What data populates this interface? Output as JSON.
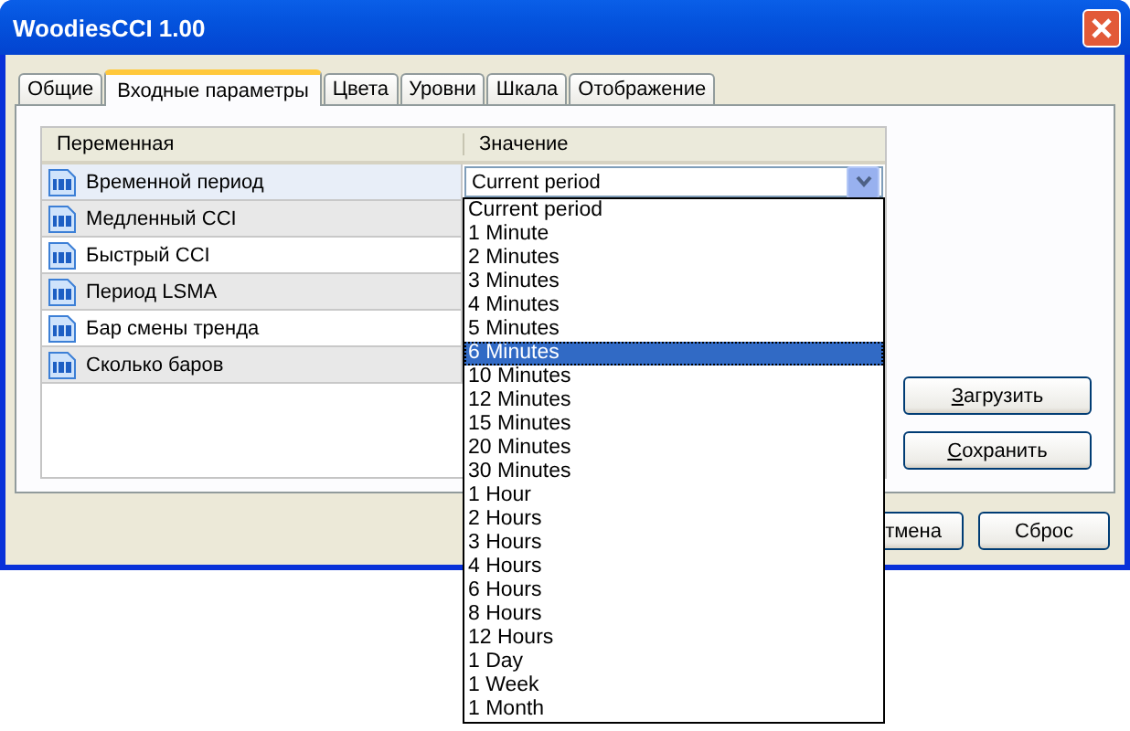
{
  "window": {
    "title": "WoodiesCCI 1.00"
  },
  "tabs": [
    {
      "label": "Общие",
      "selected": false
    },
    {
      "label": "Входные параметры",
      "selected": true
    },
    {
      "label": "Цвета",
      "selected": false
    },
    {
      "label": "Уровни",
      "selected": false
    },
    {
      "label": "Шкала",
      "selected": false
    },
    {
      "label": "Отображение",
      "selected": false
    }
  ],
  "table": {
    "columns": [
      "Переменная",
      "Значение"
    ],
    "rows": [
      {
        "name": "Временной период",
        "selected": true,
        "value": {
          "kind": "combo",
          "text": "Current period",
          "expanded": true
        }
      },
      {
        "name": "Медленный CCI",
        "selected": false
      },
      {
        "name": "Быстрый CCI",
        "selected": false
      },
      {
        "name": "Период LSMA",
        "selected": false
      },
      {
        "name": "Бар смены тренда",
        "selected": false
      },
      {
        "name": "Сколько баров",
        "selected": false
      }
    ]
  },
  "dropdown": {
    "options": [
      {
        "label": "Current period",
        "selected": false
      },
      {
        "label": "1 Minute",
        "selected": false
      },
      {
        "label": "2 Minutes",
        "selected": false
      },
      {
        "label": "3 Minutes",
        "selected": false
      },
      {
        "label": "4 Minutes",
        "selected": false
      },
      {
        "label": "5 Minutes",
        "selected": false
      },
      {
        "label": "6 Minutes",
        "selected": true
      },
      {
        "label": "10 Minutes",
        "selected": false
      },
      {
        "label": "12 Minutes",
        "selected": false
      },
      {
        "label": "15 Minutes",
        "selected": false
      },
      {
        "label": "20 Minutes",
        "selected": false
      },
      {
        "label": "30 Minutes",
        "selected": false
      },
      {
        "label": "1 Hour",
        "selected": false
      },
      {
        "label": "2 Hours",
        "selected": false
      },
      {
        "label": "3 Hours",
        "selected": false
      },
      {
        "label": "4 Hours",
        "selected": false
      },
      {
        "label": "6 Hours",
        "selected": false
      },
      {
        "label": "8 Hours",
        "selected": false
      },
      {
        "label": "12 Hours",
        "selected": false
      },
      {
        "label": "1 Day",
        "selected": false
      },
      {
        "label": "1 Week",
        "selected": false
      },
      {
        "label": "1 Month",
        "selected": false
      }
    ]
  },
  "side_buttons": [
    {
      "label": "Загрузить",
      "first_letter_underlined": true
    },
    {
      "label": "Сохранить",
      "first_letter_underlined": true
    }
  ],
  "footer_buttons": [
    "тмена",
    "Сброс"
  ]
}
